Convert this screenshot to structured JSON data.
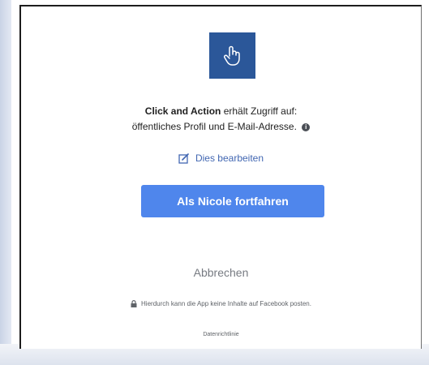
{
  "app": {
    "name": "Click and Action",
    "icon": "hand-pointer-icon",
    "icon_bg": "#2b5799"
  },
  "permission": {
    "line1_rest": "erhält Zugriff auf:",
    "line2": "öffentliches Profil und E-Mail-Adresse.",
    "info_icon": "info-icon"
  },
  "edit": {
    "label": "Dies bearbeiten",
    "icon": "edit-icon"
  },
  "continue_button": {
    "label": "Als Nicole fortfahren",
    "color": "#4f86ec"
  },
  "cancel_label": "Abbrechen",
  "notice": {
    "icon": "lock-icon",
    "text": "Hierdurch kann die App keine Inhalte auf Facebook posten."
  },
  "policy_link": "Datenrichtlinie"
}
